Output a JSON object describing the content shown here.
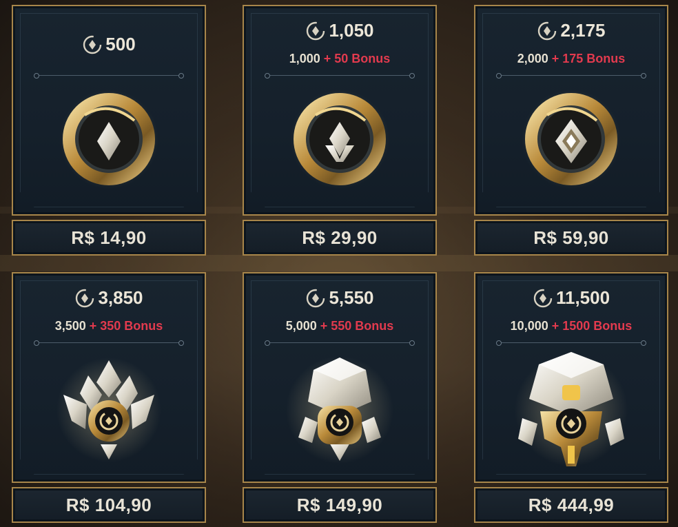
{
  "store": {
    "packs": [
      {
        "amount": "500",
        "base": "",
        "bonus": "",
        "price": "R$ 14,90"
      },
      {
        "amount": "1,050",
        "base": "1,000",
        "bonus": "+ 50 Bonus",
        "price": "R$ 29,90"
      },
      {
        "amount": "2,175",
        "base": "2,000",
        "bonus": "+ 175 Bonus",
        "price": "R$ 59,90"
      },
      {
        "amount": "3,850",
        "base": "3,500",
        "bonus": "+ 350 Bonus",
        "price": "R$ 104,90"
      },
      {
        "amount": "5,550",
        "base": "5,000",
        "bonus": "+ 550 Bonus",
        "price": "R$ 149,90"
      },
      {
        "amount": "11,500",
        "base": "10,000",
        "bonus": "+ 1500 Bonus",
        "price": "R$ 444,99"
      }
    ]
  },
  "colors": {
    "frame": "#a8864a",
    "bonus_accent": "#e23a4e",
    "panel": "#15202b"
  },
  "icons": {
    "currency": "rp-coin-icon"
  }
}
